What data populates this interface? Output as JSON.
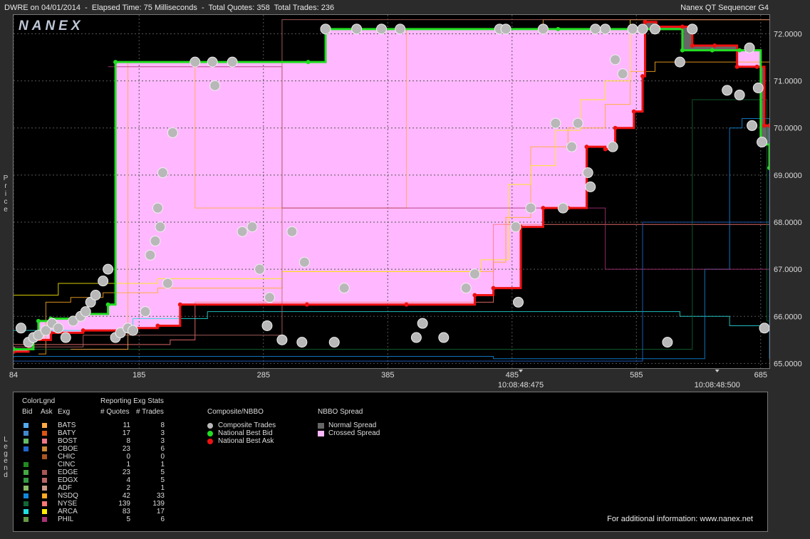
{
  "header": {
    "left_text": "DWRE on 04/01/2014  -  Elapsed Time: 75 Milliseconds  -  Total Quotes: 358  Total Trades: 236",
    "right_text": "Nanex QT Sequencer G4",
    "logo": "NANEX"
  },
  "axis": {
    "price_label": "Price",
    "legend_label": "Legend"
  },
  "chart_data": {
    "type": "line",
    "title": "DWRE on 04/01/2014",
    "xlabel": "",
    "ylabel": "Price",
    "xlim": [
      84,
      692
    ],
    "ylim": [
      64.9,
      72.4
    ],
    "x_ticks": [
      "84",
      "185",
      "285",
      "385",
      "485",
      "585",
      "685"
    ],
    "x_time_labels": [
      {
        "x": 492,
        "label": "10:08:48:475"
      },
      {
        "x": 650,
        "label": "10:08:48:500"
      }
    ],
    "y_ticks": [
      "72.0000",
      "71.0000",
      "70.0000",
      "69.0000",
      "68.0000",
      "67.0000",
      "66.0000",
      "65.0000"
    ],
    "series": [
      {
        "name": "National Best Bid",
        "color": "#22dd22",
        "points": [
          [
            84,
            65.3
          ],
          [
            100,
            65.6
          ],
          [
            104,
            65.9
          ],
          [
            114,
            65.95
          ],
          [
            140,
            66.05
          ],
          [
            160,
            66.25
          ],
          [
            166,
            71.4
          ],
          [
            321,
            71.4
          ],
          [
            335,
            72.1
          ],
          [
            482,
            72.1
          ],
          [
            522,
            72.1
          ],
          [
            585,
            72.1
          ],
          [
            601,
            72.1
          ],
          [
            622,
            71.65
          ],
          [
            646,
            71.65
          ],
          [
            668,
            71.65
          ],
          [
            685,
            69.65
          ],
          [
            692,
            69.15
          ]
        ]
      },
      {
        "name": "National Best Ask",
        "color": "#ee1111",
        "points": [
          [
            84,
            65.25
          ],
          [
            96,
            65.5
          ],
          [
            114,
            65.65
          ],
          [
            140,
            65.7
          ],
          [
            180,
            65.75
          ],
          [
            200,
            65.8
          ],
          [
            218,
            66.25
          ],
          [
            320,
            66.25
          ],
          [
            400,
            66.25
          ],
          [
            455,
            66.45
          ],
          [
            470,
            66.6
          ],
          [
            492,
            67.9
          ],
          [
            510,
            68.3
          ],
          [
            530,
            68.3
          ],
          [
            545,
            69.6
          ],
          [
            560,
            69.55
          ],
          [
            568,
            70.0
          ],
          [
            583,
            70.35
          ],
          [
            590,
            71.1
          ],
          [
            592,
            72.25
          ],
          [
            601,
            72.15
          ],
          [
            622,
            72.15
          ],
          [
            630,
            71.75
          ],
          [
            648,
            71.75
          ],
          [
            666,
            71.3
          ],
          [
            682,
            71.3
          ],
          [
            688,
            70.05
          ],
          [
            692,
            70.05
          ]
        ]
      }
    ],
    "composite_trades_sample": [
      [
        90,
        65.75
      ],
      [
        96,
        65.45
      ],
      [
        100,
        65.55
      ],
      [
        104,
        65.6
      ],
      [
        110,
        65.7
      ],
      [
        115,
        65.85
      ],
      [
        120,
        65.75
      ],
      [
        126,
        65.55
      ],
      [
        132,
        65.9
      ],
      [
        138,
        66.0
      ],
      [
        142,
        66.1
      ],
      [
        146,
        66.3
      ],
      [
        150,
        66.45
      ],
      [
        156,
        66.75
      ],
      [
        160,
        67.0
      ],
      [
        166,
        65.55
      ],
      [
        170,
        65.65
      ],
      [
        176,
        65.75
      ],
      [
        180,
        65.7
      ],
      [
        190,
        66.1
      ],
      [
        194,
        67.3
      ],
      [
        198,
        67.6
      ],
      [
        200,
        68.3
      ],
      [
        202,
        67.9
      ],
      [
        204,
        69.05
      ],
      [
        208,
        66.7
      ],
      [
        212,
        69.9
      ],
      [
        246,
        70.9
      ],
      [
        230,
        71.4
      ],
      [
        244,
        71.4
      ],
      [
        260,
        71.4
      ],
      [
        268,
        67.8
      ],
      [
        276,
        67.9
      ],
      [
        282,
        67.0
      ],
      [
        288,
        65.8
      ],
      [
        290,
        66.4
      ],
      [
        300,
        65.5
      ],
      [
        308,
        67.8
      ],
      [
        316,
        65.45
      ],
      [
        318,
        67.15
      ],
      [
        335,
        72.1
      ],
      [
        342,
        65.45
      ],
      [
        350,
        66.6
      ],
      [
        360,
        72.1
      ],
      [
        380,
        72.1
      ],
      [
        395,
        72.1
      ],
      [
        408,
        65.55
      ],
      [
        413,
        65.85
      ],
      [
        430,
        65.55
      ],
      [
        448,
        66.6
      ],
      [
        455,
        66.9
      ],
      [
        475,
        72.1
      ],
      [
        480,
        72.1
      ],
      [
        488,
        67.9
      ],
      [
        490,
        66.3
      ],
      [
        500,
        68.3
      ],
      [
        510,
        72.1
      ],
      [
        520,
        70.1
      ],
      [
        526,
        68.3
      ],
      [
        533,
        69.6
      ],
      [
        538,
        70.1
      ],
      [
        546,
        69.05
      ],
      [
        548,
        68.75
      ],
      [
        552,
        72.1
      ],
      [
        560,
        72.1
      ],
      [
        566,
        69.6
      ],
      [
        568,
        71.45
      ],
      [
        574,
        71.15
      ],
      [
        582,
        72.1
      ],
      [
        590,
        72.1
      ],
      [
        600,
        72.1
      ],
      [
        610,
        65.45
      ],
      [
        620,
        71.4
      ],
      [
        630,
        72.1
      ],
      [
        658,
        70.8
      ],
      [
        668,
        70.7
      ],
      [
        676,
        71.7
      ],
      [
        678,
        70.05
      ],
      [
        683,
        70.85
      ],
      [
        686,
        69.7
      ],
      [
        688,
        65.75
      ]
    ]
  },
  "legend": {
    "color_legend_title": "ColorLgnd",
    "col_bid": "Bid",
    "col_ask": "Ask",
    "col_exg": "Exg",
    "stats_title": "Reporting Exg Stats",
    "col_quotes": "# Quotes",
    "col_trades": "# Trades",
    "composite_title": "Composite/NBBO",
    "composite_items": [
      {
        "label": "Composite Trades",
        "color": "#b8b8b8"
      },
      {
        "label": "National Best Bid",
        "color": "#22dd22"
      },
      {
        "label": "National Best Ask",
        "color": "#ee1111"
      }
    ],
    "spread_title": "NBBO Spread",
    "spread_items": [
      {
        "label": "Normal Spread",
        "color": "#666666"
      },
      {
        "label": "Crossed Spread",
        "color": "#ffb8ff"
      }
    ],
    "exchanges": [
      {
        "exg": "BATS",
        "quotes": "11",
        "trades": "8",
        "bid_color": "#55aaee",
        "ask_color": "#ffaa44"
      },
      {
        "exg": "BATY",
        "quotes": "17",
        "trades": "3",
        "bid_color": "#4488cc",
        "ask_color": "#dd5511"
      },
      {
        "exg": "BOST",
        "quotes": "8",
        "trades": "3",
        "bid_color": "#66bb66",
        "ask_color": "#ee7788"
      },
      {
        "exg": "CBOE",
        "quotes": "23",
        "trades": "6",
        "bid_color": "#2266cc",
        "ask_color": "#cc8833"
      },
      {
        "exg": "CHIC",
        "quotes": "0",
        "trades": "0",
        "bid_color": "#000000",
        "ask_color": "#aa5522"
      },
      {
        "exg": "CINC",
        "quotes": "1",
        "trades": "1",
        "bid_color": "#228822",
        "ask_color": "#000000"
      },
      {
        "exg": "EDGE",
        "quotes": "23",
        "trades": "5",
        "bid_color": "#44aa44",
        "ask_color": "#aa5555"
      },
      {
        "exg": "EDGX",
        "quotes": "4",
        "trades": "5",
        "bid_color": "#339944",
        "ask_color": "#bb6666"
      },
      {
        "exg": "ADF",
        "quotes": "2",
        "trades": "1",
        "bid_color": "#88bb66",
        "ask_color": "#cc9988"
      },
      {
        "exg": "NSDQ",
        "quotes": "42",
        "trades": "33",
        "bid_color": "#1188dd",
        "ask_color": "#ffaa22"
      },
      {
        "exg": "NYSE",
        "quotes": "139",
        "trades": "139",
        "bid_color": "#116633",
        "ask_color": "#ff7777"
      },
      {
        "exg": "ARCA",
        "quotes": "83",
        "trades": "17",
        "bid_color": "#22dddd",
        "ask_color": "#ffee00"
      },
      {
        "exg": "PHIL",
        "quotes": "5",
        "trades": "6",
        "bid_color": "#669944",
        "ask_color": "#aa3377"
      }
    ],
    "footer": "For additional information: www.nanex.net"
  }
}
